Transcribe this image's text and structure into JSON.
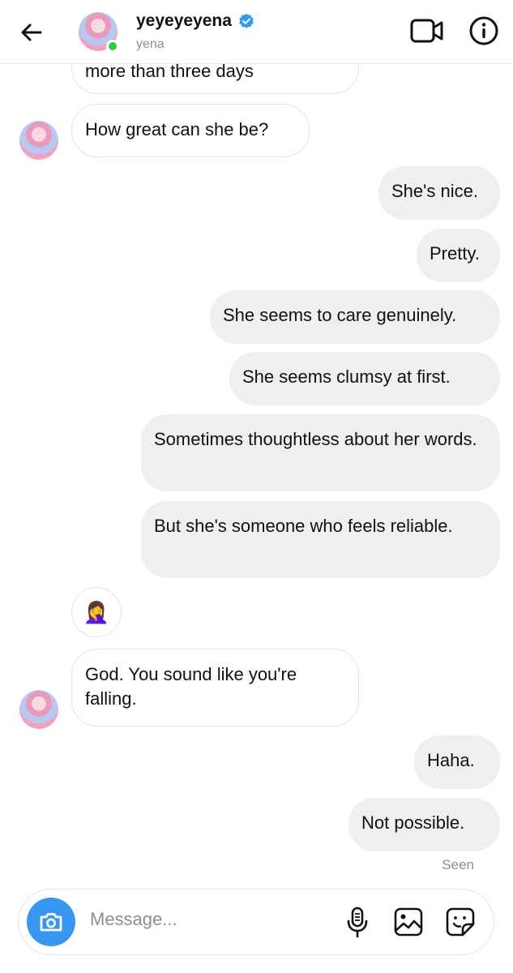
{
  "header": {
    "username": "yeyeyeyena",
    "subtitle": "yena"
  },
  "messages": [
    {
      "from": "them",
      "text": "more than three days"
    },
    {
      "from": "them",
      "text": "How great can she be?"
    },
    {
      "from": "me",
      "text": "She's nice."
    },
    {
      "from": "me",
      "text": "Pretty."
    },
    {
      "from": "me",
      "text": "She seems to care genuinely."
    },
    {
      "from": "me",
      "text": "She seems clumsy at first."
    },
    {
      "from": "me",
      "text": "Sometimes thoughtless about her words."
    },
    {
      "from": "me",
      "text": "But she's someone who feels reliable."
    },
    {
      "from": "them",
      "text": "🤦‍♀️"
    },
    {
      "from": "them",
      "text": "God. You sound like you're falling."
    },
    {
      "from": "me",
      "text": "Haha."
    },
    {
      "from": "me",
      "text": "Not possible."
    }
  ],
  "status": {
    "seen": "Seen"
  },
  "composer": {
    "placeholder": "Message..."
  },
  "colors": {
    "accent": "#3797f0",
    "online": "#2ecc40",
    "verified": "#3897f0",
    "bubble_out": "#efefef"
  },
  "icons": [
    "back-arrow-icon",
    "verified-badge-icon",
    "video-call-icon",
    "info-icon",
    "camera-icon",
    "microphone-icon",
    "gallery-icon",
    "sticker-icon"
  ]
}
